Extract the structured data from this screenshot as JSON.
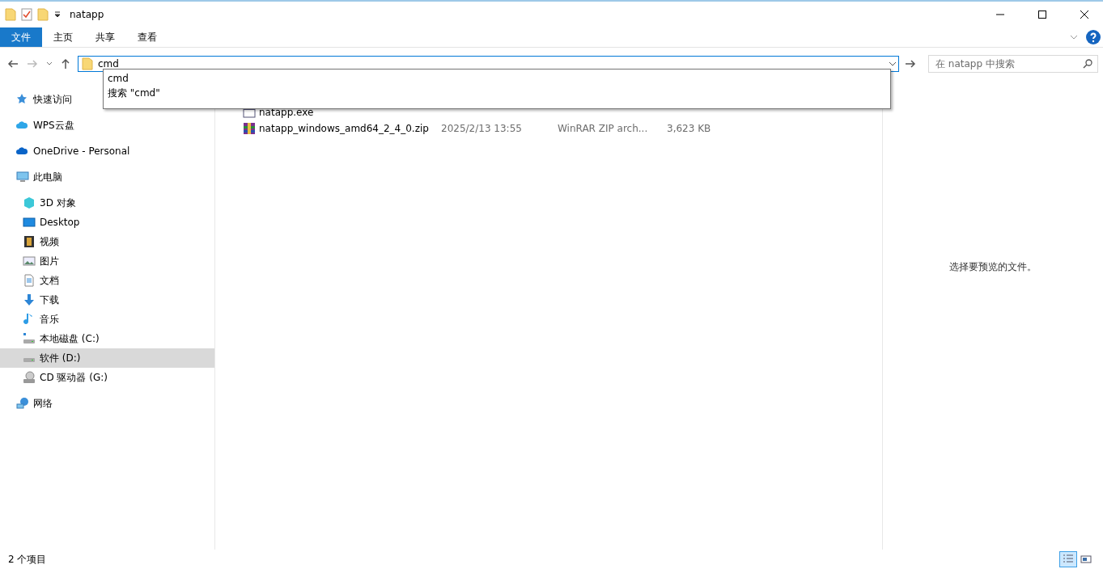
{
  "window": {
    "title": "natapp"
  },
  "ribbon_tabs": [
    {
      "label": "文件",
      "kind": "file"
    },
    {
      "label": "主页",
      "kind": "tab"
    },
    {
      "label": "共享",
      "kind": "tab"
    },
    {
      "label": "查看",
      "kind": "tab"
    }
  ],
  "address": {
    "value": "cmd",
    "suggestions": [
      "cmd",
      "搜索 \"cmd\""
    ]
  },
  "search": {
    "placeholder": "在 natapp 中搜索"
  },
  "sidebar": {
    "items": [
      {
        "label": "快速访问",
        "selected": false
      },
      {
        "label": "WPS云盘",
        "selected": false
      },
      {
        "label": "OneDrive - Personal",
        "selected": false
      },
      {
        "label": "此电脑",
        "selected": false,
        "children": [
          {
            "label": "3D 对象",
            "selected": false
          },
          {
            "label": "Desktop",
            "selected": false
          },
          {
            "label": "视频",
            "selected": false
          },
          {
            "label": "图片",
            "selected": false
          },
          {
            "label": "文档",
            "selected": false
          },
          {
            "label": "下载",
            "selected": false
          },
          {
            "label": "音乐",
            "selected": false
          },
          {
            "label": "本地磁盘 (C:)",
            "selected": false
          },
          {
            "label": "软件 (D:)",
            "selected": true
          },
          {
            "label": "CD 驱动器 (G:)",
            "selected": false
          }
        ]
      },
      {
        "label": "网络",
        "selected": false
      }
    ]
  },
  "files": [
    {
      "name": "natapp.exe",
      "kind": "exe"
    },
    {
      "name": "natapp_windows_amd64_2_4_0.zip",
      "date": "2025/2/13 13:55",
      "type": "WinRAR ZIP arch...",
      "size": "3,623 KB",
      "kind": "zip"
    }
  ],
  "preview": {
    "message": "选择要预览的文件。"
  },
  "status_bar": {
    "count": "2 个项目"
  },
  "view_buttons": [
    {
      "kind": "details",
      "selected": true
    },
    {
      "kind": "tiles",
      "selected": false
    }
  ]
}
